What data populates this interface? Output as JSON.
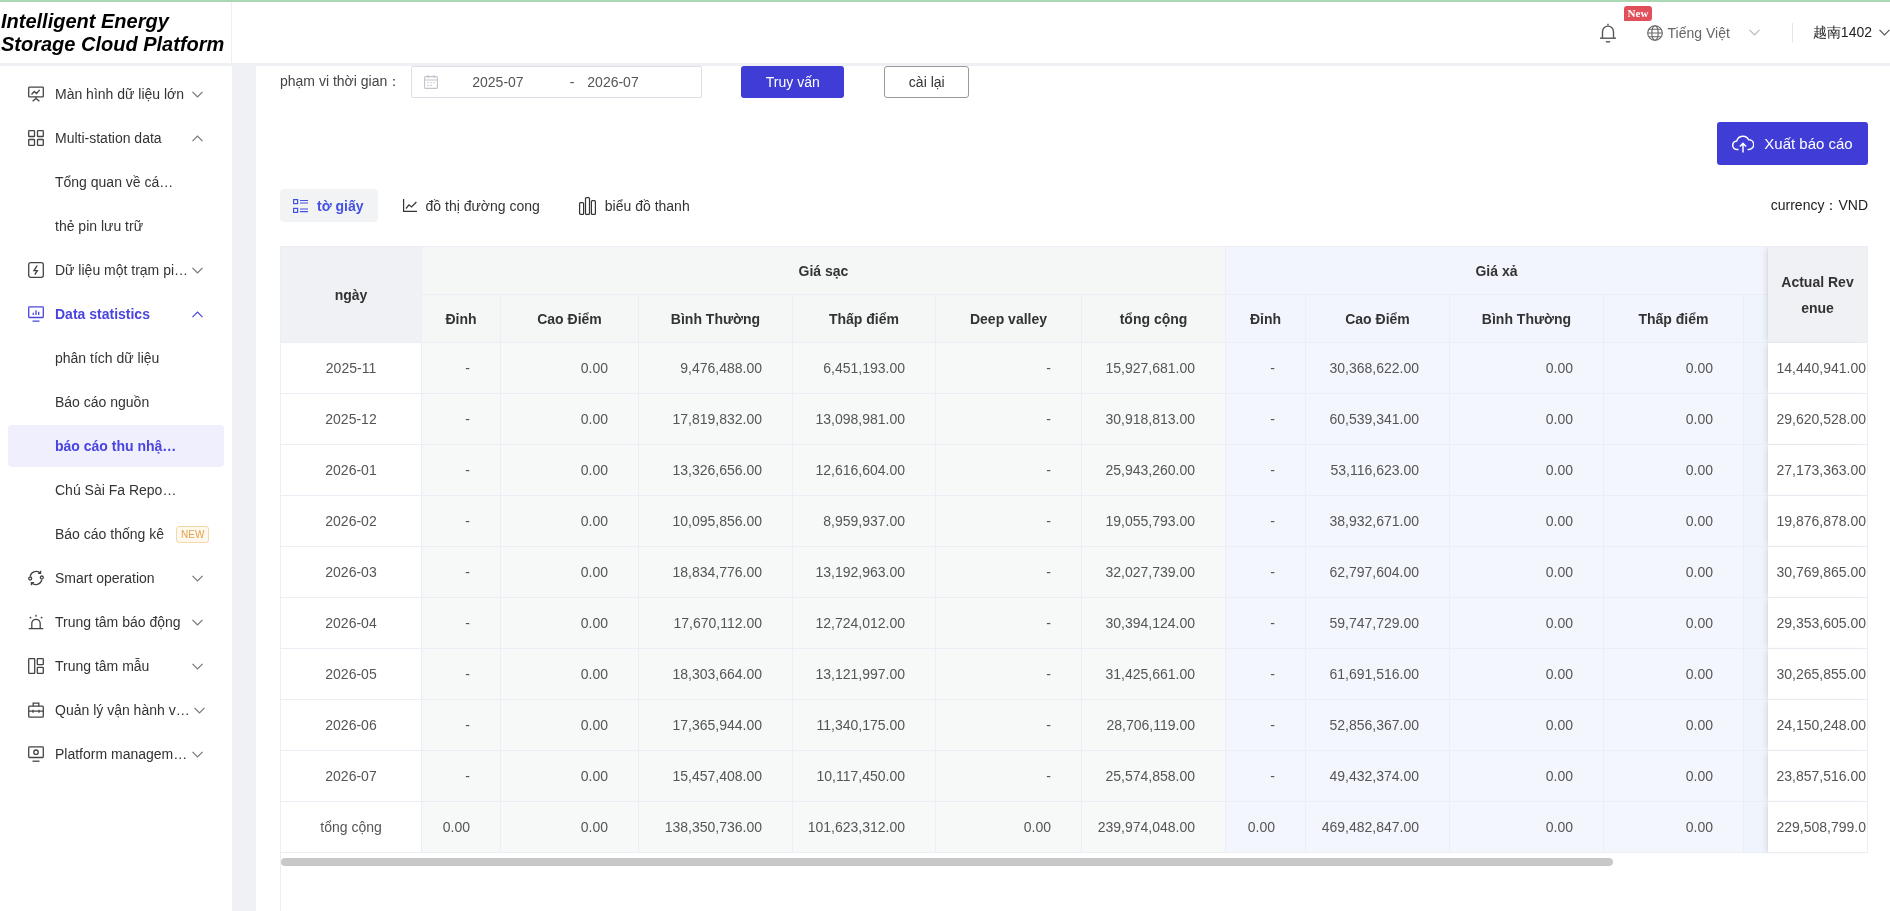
{
  "top_bar": {
    "logo": "Intelligent Energy Storage Cloud Platform",
    "notification_badge": "New",
    "language": "Tiếng Việt",
    "user": "越南1402"
  },
  "sidebar": {
    "items": [
      {
        "label": "Màn hình dữ liệu lớn",
        "selected": false,
        "expanded": false
      },
      {
        "label": "Multi-station data",
        "selected": false,
        "expanded": true,
        "children": [
          {
            "label": "Tổng quan về cá…",
            "selected": false
          },
          {
            "label": "thẻ pin lưu trữ",
            "selected": false
          }
        ]
      },
      {
        "label": "Dữ liệu một trạm pi…",
        "selected": false,
        "expanded": false
      },
      {
        "label": "Data statistics",
        "selected": true,
        "expanded": true,
        "children": [
          {
            "label": "phân tích dữ liệu",
            "selected": false
          },
          {
            "label": "Báo cáo nguồn",
            "selected": false
          },
          {
            "label": "báo cáo thu nhậ…",
            "selected": true
          },
          {
            "label": "Chú Sài Fa Repo…",
            "selected": false
          },
          {
            "label": "Báo cáo thống kê",
            "selected": false,
            "badge": "NEW"
          }
        ]
      },
      {
        "label": "Smart operation",
        "selected": false,
        "expanded": false
      },
      {
        "label": "Trung tâm báo động",
        "selected": false,
        "expanded": false
      },
      {
        "label": "Trung tâm mẫu",
        "selected": false,
        "expanded": false
      },
      {
        "label": "Quản lý vận hành v…",
        "selected": false,
        "expanded": false
      },
      {
        "label": "Platform managem…",
        "selected": false,
        "expanded": false
      }
    ]
  },
  "filter": {
    "label": "phạm vi thời gian：",
    "start": "2025-07",
    "separator": "-",
    "end": "2026-07",
    "buttons": [
      {
        "label": "Truy vấn",
        "kind": "primary"
      },
      {
        "label": "cài lại",
        "kind": "default"
      }
    ]
  },
  "export_button": "Xuất báo cáo",
  "view_tabs": [
    {
      "label": "tờ giấy",
      "selected": true
    },
    {
      "label": "đồ thị đường cong",
      "selected": false
    },
    {
      "label": "biểu đồ thanh",
      "selected": false
    }
  ],
  "currency": "currency：VND",
  "table": {
    "date_column": "ngày",
    "groups": [
      {
        "label": "Giá sạc",
        "kind": "charge",
        "columns": [
          "Đỉnh",
          "Cao Điểm",
          "Bình Thường",
          "Thấp điểm",
          "Deep valley",
          "tổng cộng"
        ]
      },
      {
        "label": "Giá xả",
        "kind": "discharge",
        "columns": [
          "Đỉnh",
          "Cao Điểm",
          "Bình Thường",
          "Thấp điểm"
        ]
      }
    ],
    "total_column": "Actual Revenue",
    "rows": [
      {
        "date": "2025-11",
        "values": [
          [
            "-",
            "0.00",
            "9,476,488.00",
            "6,451,193.00",
            "-",
            "15,927,681.00"
          ],
          [
            "-",
            "30,368,622.00",
            "0.00",
            "0.00"
          ]
        ],
        "actual_revenue": "14,440,941.00"
      },
      {
        "date": "2025-12",
        "values": [
          [
            "-",
            "0.00",
            "17,819,832.00",
            "13,098,981.00",
            "-",
            "30,918,813.00"
          ],
          [
            "-",
            "60,539,341.00",
            "0.00",
            "0.00"
          ]
        ],
        "actual_revenue": "29,620,528.00"
      },
      {
        "date": "2026-01",
        "values": [
          [
            "-",
            "0.00",
            "13,326,656.00",
            "12,616,604.00",
            "-",
            "25,943,260.00"
          ],
          [
            "-",
            "53,116,623.00",
            "0.00",
            "0.00"
          ]
        ],
        "actual_revenue": "27,173,363.00"
      },
      {
        "date": "2026-02",
        "values": [
          [
            "-",
            "0.00",
            "10,095,856.00",
            "8,959,937.00",
            "-",
            "19,055,793.00"
          ],
          [
            "-",
            "38,932,671.00",
            "0.00",
            "0.00"
          ]
        ],
        "actual_revenue": "19,876,878.00"
      },
      {
        "date": "2026-03",
        "values": [
          [
            "-",
            "0.00",
            "18,834,776.00",
            "13,192,963.00",
            "-",
            "32,027,739.00"
          ],
          [
            "-",
            "62,797,604.00",
            "0.00",
            "0.00"
          ]
        ],
        "actual_revenue": "30,769,865.00"
      },
      {
        "date": "2026-04",
        "values": [
          [
            "-",
            "0.00",
            "17,670,112.00",
            "12,724,012.00",
            "-",
            "30,394,124.00"
          ],
          [
            "-",
            "59,747,729.00",
            "0.00",
            "0.00"
          ]
        ],
        "actual_revenue": "29,353,605.00"
      },
      {
        "date": "2026-05",
        "values": [
          [
            "-",
            "0.00",
            "18,303,664.00",
            "13,121,997.00",
            "-",
            "31,425,661.00"
          ],
          [
            "-",
            "61,691,516.00",
            "0.00",
            "0.00"
          ]
        ],
        "actual_revenue": "30,265,855.00"
      },
      {
        "date": "2026-06",
        "values": [
          [
            "-",
            "0.00",
            "17,365,944.00",
            "11,340,175.00",
            "-",
            "28,706,119.00"
          ],
          [
            "-",
            "52,856,367.00",
            "0.00",
            "0.00"
          ]
        ],
        "actual_revenue": "24,150,248.00"
      },
      {
        "date": "2026-07",
        "values": [
          [
            "-",
            "0.00",
            "15,457,408.00",
            "10,117,450.00",
            "-",
            "25,574,858.00"
          ],
          [
            "-",
            "49,432,374.00",
            "0.00",
            "0.00"
          ]
        ],
        "actual_revenue": "23,857,516.00"
      },
      {
        "date": "tổng cộng",
        "values": [
          [
            "0.00",
            "0.00",
            "138,350,736.00",
            "101,623,312.00",
            "0.00",
            "239,974,048.00"
          ],
          [
            "0.00",
            "469,482,847.00",
            "0.00",
            "0.00"
          ]
        ],
        "actual_revenue": "229,508,799.0"
      }
    ]
  }
}
